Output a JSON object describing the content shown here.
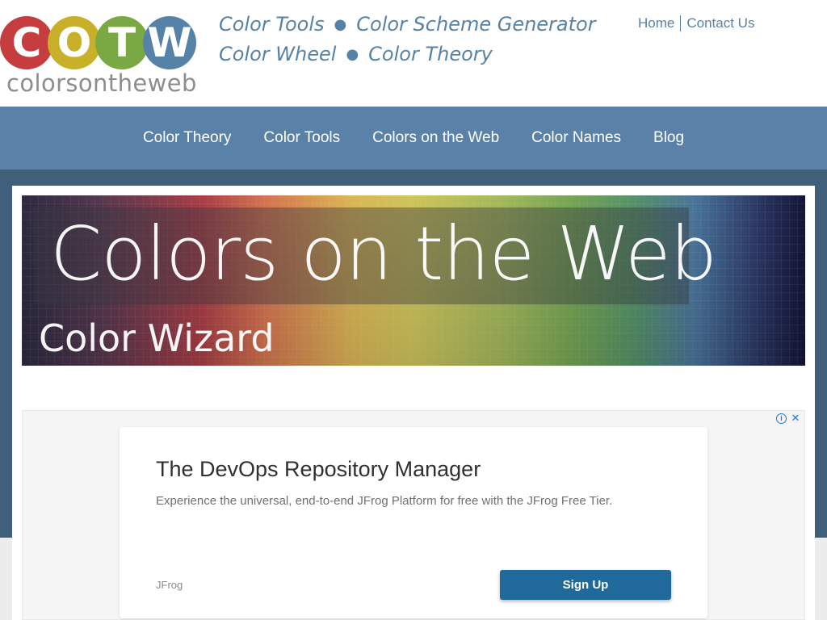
{
  "logo": {
    "letters": [
      "C",
      "O",
      "T",
      "W"
    ],
    "circle_colors": [
      "#c63d3f",
      "#c9b02b",
      "#7aa944",
      "#5682a8"
    ],
    "wordmark": "colorsontheweb"
  },
  "quick_links": {
    "row1": [
      "Color Tools",
      "Color Scheme Generator"
    ],
    "row2": [
      "Color Wheel",
      "Color Theory"
    ],
    "separator": "●"
  },
  "utility_nav": [
    "Home",
    "Contact Us"
  ],
  "main_nav": [
    "Color Theory",
    "Color Tools",
    "Colors on the Web",
    "Color Names",
    "Blog"
  ],
  "hero": {
    "title": "Colors on the Web",
    "subtitle": "Color Wizard"
  },
  "ad": {
    "headline": "The DevOps Repository Manager",
    "description": "Experience the universal, end-to-end JFrog Platform for free with the JFrog Free Tier.",
    "advertiser": "JFrog",
    "cta_label": "Sign Up",
    "info_icon": "i",
    "close_icon": "✕"
  },
  "colors": {
    "accent": "#5682a8",
    "nav_bar": "#5a82a8",
    "band": "#3f5f7b",
    "cta": "#1f6a9a"
  }
}
